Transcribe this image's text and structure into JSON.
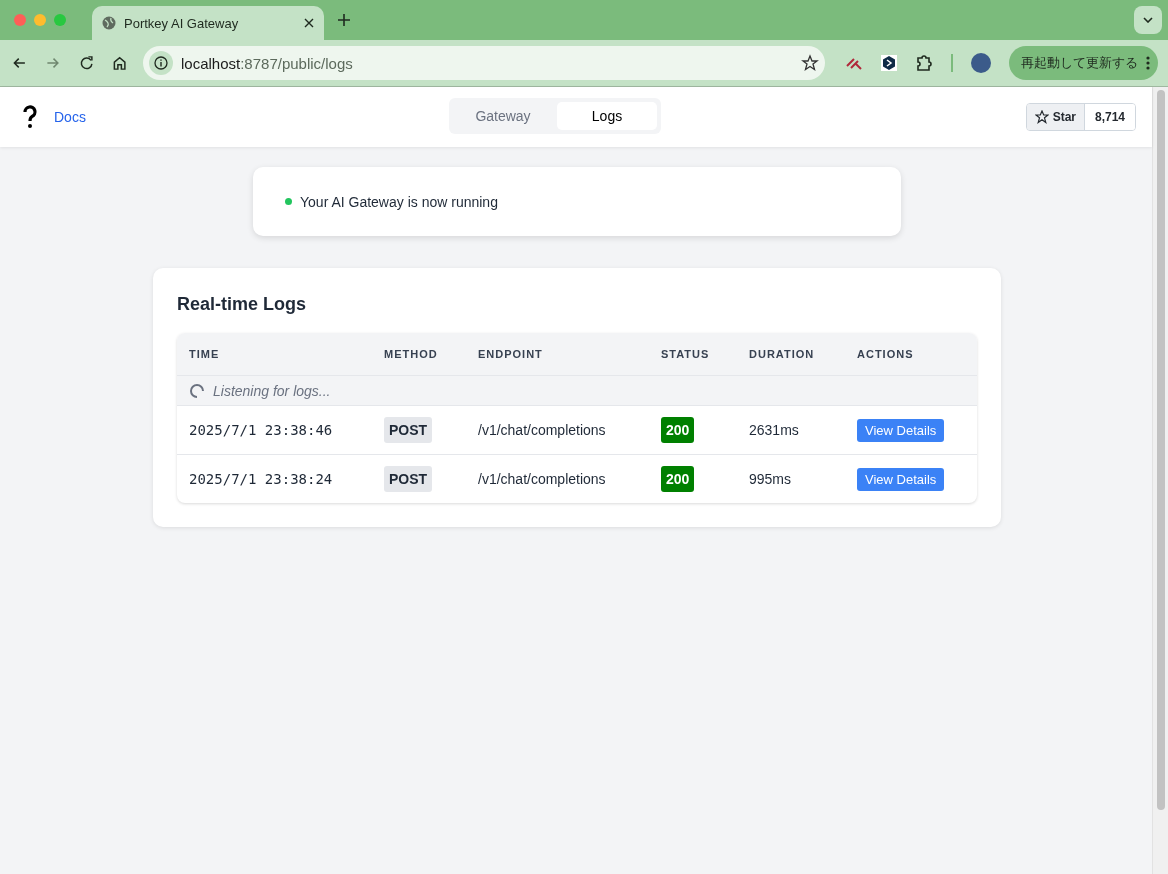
{
  "browser": {
    "tab_title": "Portkey AI Gateway",
    "url_host": "localhost",
    "url_path": ":8787/public/logs",
    "update_button": "再起動して更新する"
  },
  "header": {
    "docs_link": "Docs",
    "tabs": [
      {
        "label": "Gateway",
        "selected": false
      },
      {
        "label": "Logs",
        "selected": true
      }
    ],
    "star": {
      "label": "Star",
      "count": "8,714"
    }
  },
  "status_banner": {
    "text": "Your AI Gateway is now running"
  },
  "logs": {
    "title": "Real-time Logs",
    "columns": [
      "TIME",
      "METHOD",
      "ENDPOINT",
      "STATUS",
      "DURATION",
      "ACTIONS"
    ],
    "listening": "Listening for logs...",
    "rows": [
      {
        "time": "2025/7/1 23:38:46",
        "method": "POST",
        "endpoint": "/v1/chat/completions",
        "status": "200",
        "duration": "2631ms",
        "action": "View Details"
      },
      {
        "time": "2025/7/1 23:38:24",
        "method": "POST",
        "endpoint": "/v1/chat/completions",
        "status": "200",
        "duration": "995ms",
        "action": "View Details"
      }
    ]
  }
}
